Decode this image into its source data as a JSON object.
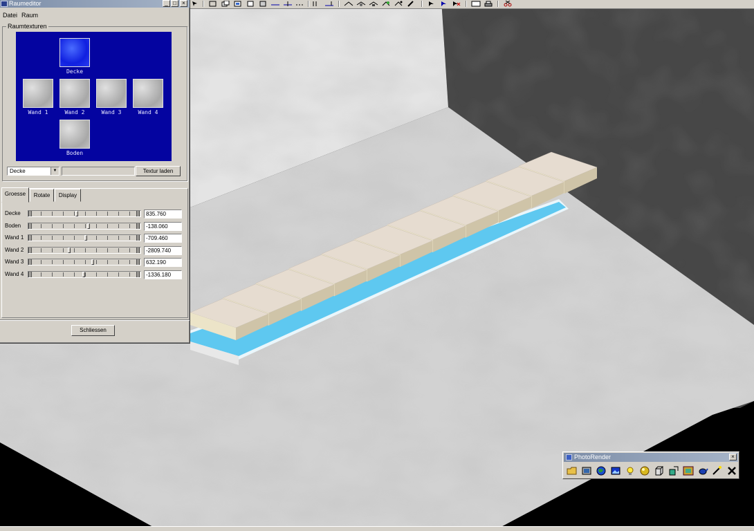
{
  "raumeditor": {
    "title": "Raumeditor",
    "menu": [
      "Datei",
      "Raum"
    ],
    "group_label": "Raumtexturen",
    "textures": {
      "decke": "Decke",
      "wand1": "Wand 1",
      "wand2": "Wand 2",
      "wand3": "Wand 3",
      "wand4": "Wand 4",
      "boden": "Boden"
    },
    "selected_texture": "Decke",
    "texture_path": "",
    "load_button": "Textur laden",
    "tabs": [
      "Groesse",
      "Rotate",
      "Display"
    ],
    "active_tab": "Groesse",
    "rows": [
      {
        "label": "Decke",
        "value": "835.760"
      },
      {
        "label": "Boden",
        "value": "-138.060"
      },
      {
        "label": "Wand 1",
        "value": "-709.460"
      },
      {
        "label": "Wand 2",
        "value": "-2809.740"
      },
      {
        "label": "Wand 3",
        "value": "632.190"
      },
      {
        "label": "Wand 4",
        "value": "-1336.180"
      }
    ],
    "close_button": "Schliessen"
  },
  "photorender": {
    "title": "PhotoRender",
    "tools": [
      "open-icon",
      "render-icon",
      "globe-icon",
      "background-icon",
      "light-icon",
      "material-icon",
      "box-icon",
      "export-icon",
      "frame-icon",
      "teapot-icon",
      "wand-icon",
      "close-x-icon"
    ]
  },
  "colors": {
    "texture_panel": "#0404a0",
    "title_bar": "#7d8ea8",
    "plank": "#e6dcd0",
    "base": "#5ec8f0",
    "floor": "#d4d4d4",
    "wall_left": "#e2e2e2",
    "wall_right": "#4a4a4a"
  }
}
